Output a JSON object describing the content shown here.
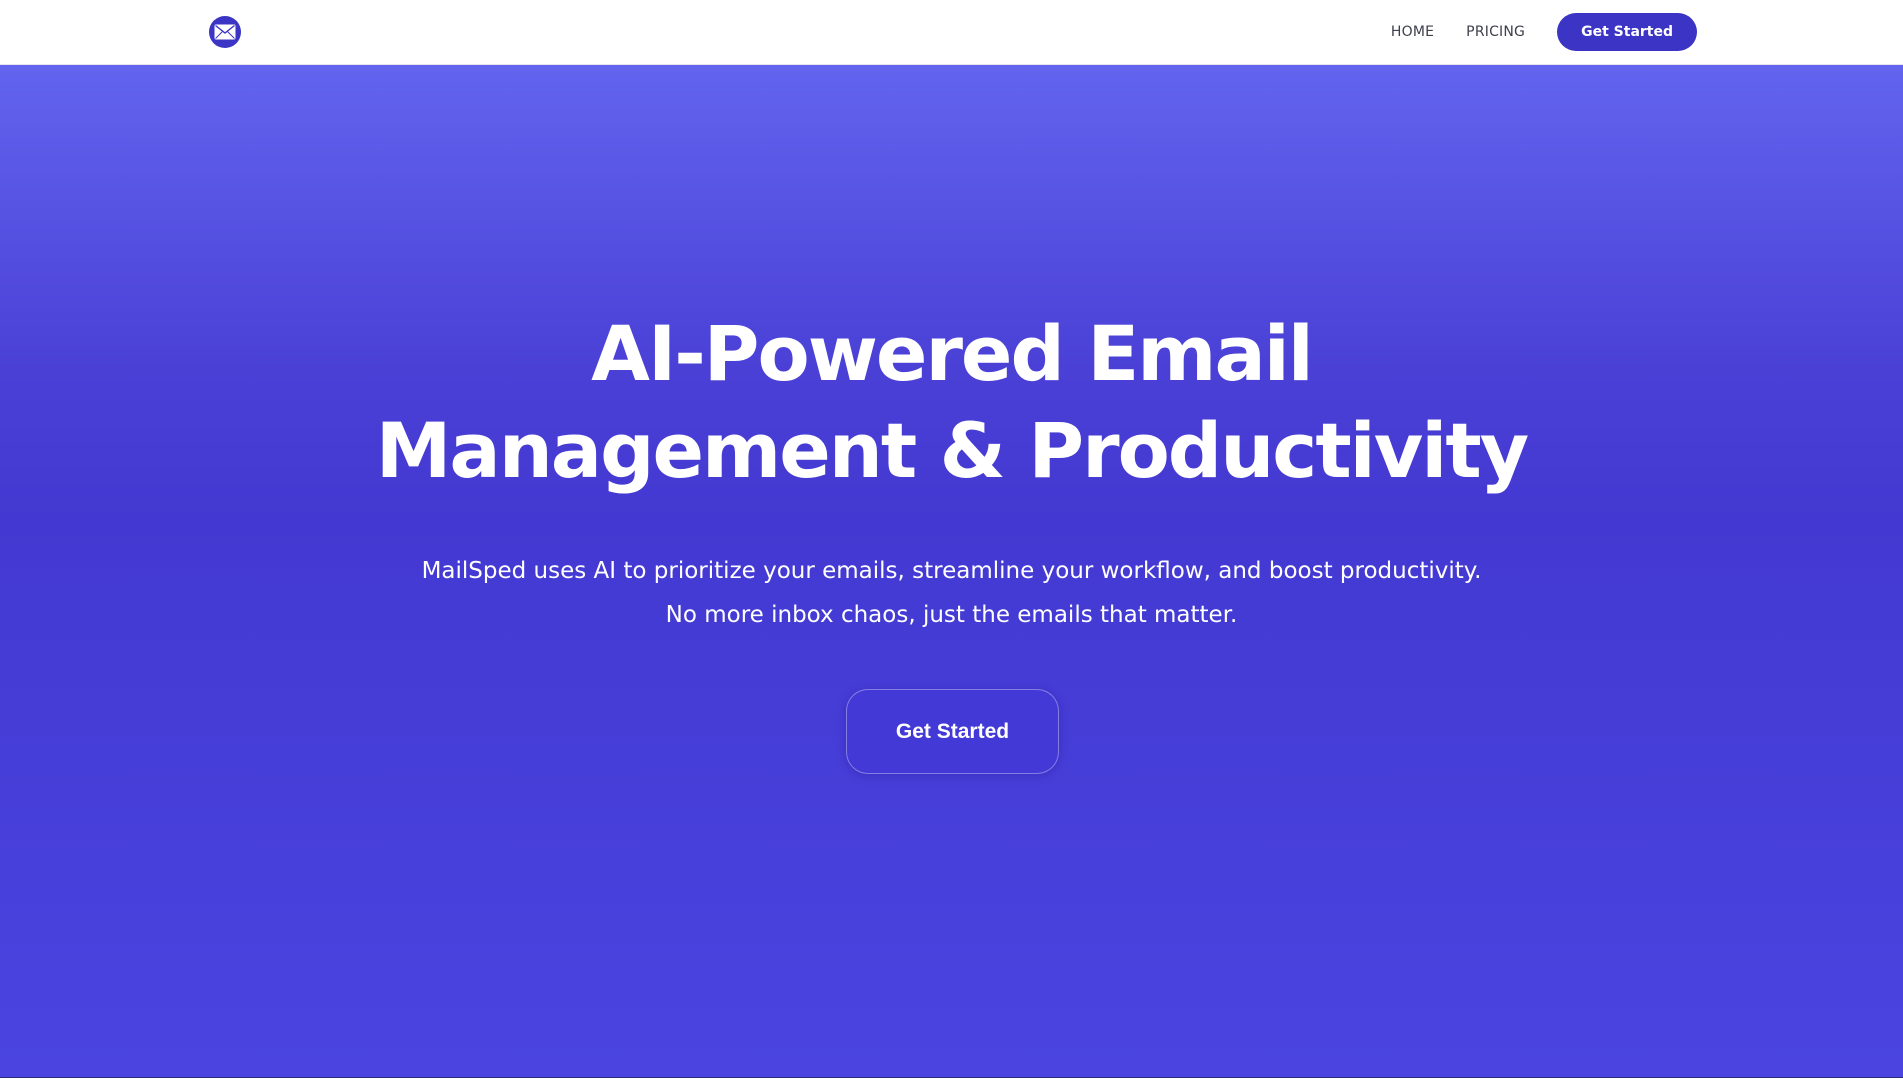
{
  "navbar": {
    "logo_icon": "envelope-icon",
    "links": [
      {
        "label": "HOME"
      },
      {
        "label": "PRICING"
      }
    ],
    "cta_label": "Get Started"
  },
  "hero": {
    "title_line1": "AI-Powered Email",
    "title_line2": "Management & Productivity",
    "subtitle_line1": "MailSped uses AI to prioritize your emails, streamline your workflow, and boost productivity.",
    "subtitle_line2": "No more inbox chaos, just the emails that matter.",
    "cta_label": "Get Started"
  },
  "colors": {
    "brand": "#3b34c4",
    "hero_gradient_top": "#6264ee",
    "hero_gradient_mid": "#4339d2",
    "hero_gradient_bottom": "#4b44e0",
    "nav_text": "#3d3f4a"
  }
}
